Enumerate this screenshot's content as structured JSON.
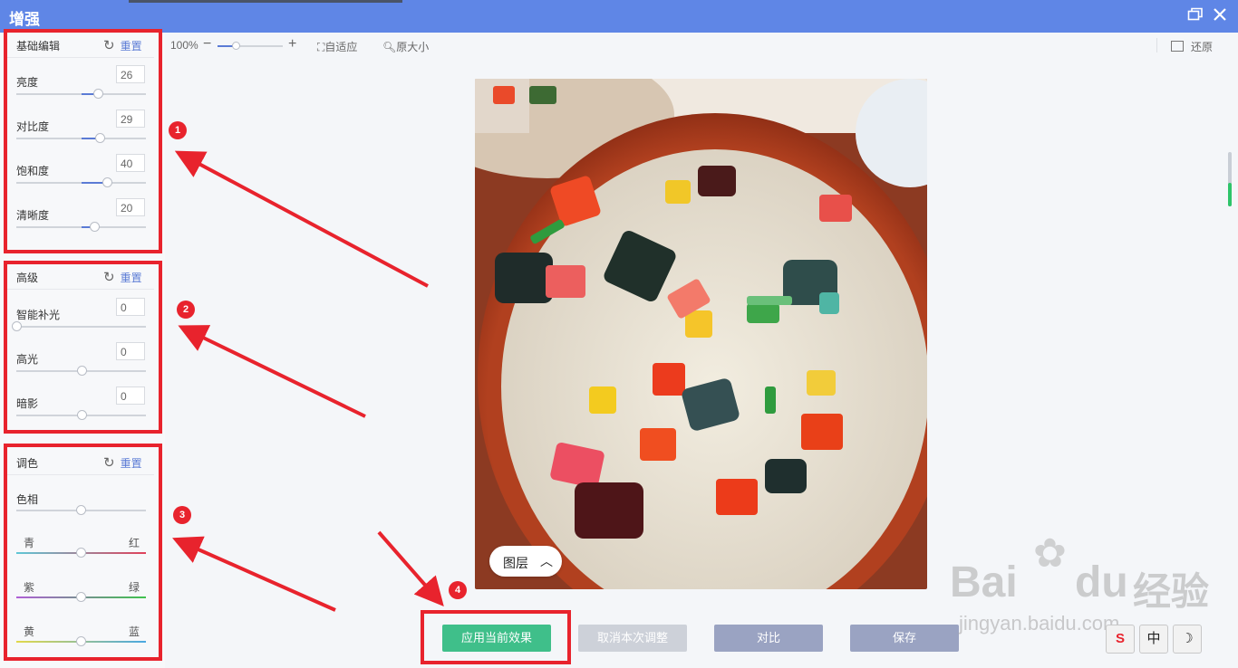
{
  "window": {
    "title": "增强",
    "restore_icon": "window-restore-icon",
    "close_icon": "close-icon"
  },
  "panels": {
    "basic": {
      "title": "基础编辑",
      "reset_label": "重置",
      "controls": [
        {
          "label": "亮度",
          "value": "26",
          "level": 0.26
        },
        {
          "label": "对比度",
          "value": "29",
          "level": 0.29
        },
        {
          "label": "饱和度",
          "value": "40",
          "level": 0.4
        },
        {
          "label": "清晰度",
          "value": "20",
          "level": 0.2
        }
      ]
    },
    "advanced": {
      "title": "高级",
      "reset_label": "重置",
      "controls": [
        {
          "label": "智能补光",
          "value": "0",
          "level": 0
        },
        {
          "label": "高光",
          "value": "0",
          "level": 0
        },
        {
          "label": "暗影",
          "value": "0",
          "level": 0
        }
      ]
    },
    "tone": {
      "title": "调色",
      "reset_label": "重置",
      "hue_label": "色相",
      "balance": [
        {
          "left": "青",
          "right": "红",
          "left_color": "#5fc7d6",
          "right_color": "#e0415a"
        },
        {
          "left": "紫",
          "right": "绿",
          "left_color": "#b05fd6",
          "right_color": "#3fc24d"
        },
        {
          "left": "黄",
          "right": "蓝",
          "left_color": "#e2d94a",
          "right_color": "#4aa8e2"
        }
      ]
    }
  },
  "toolbar": {
    "zoom": "100%",
    "fit_label": "自适应",
    "original_label": "原大小",
    "restore_label": "还原"
  },
  "layer_button": {
    "label": "图层"
  },
  "actions": {
    "apply": "应用当前效果",
    "cancel": "取消本次调整",
    "compare": "对比",
    "save": "保存"
  },
  "badges": [
    "1",
    "2",
    "3",
    "4"
  ],
  "watermark": {
    "brand": "Bai",
    "brand2": "du",
    "cn": "经验",
    "url": "jingyan.baidu.com"
  },
  "ime": {
    "s": "S",
    "zh": "中",
    "moon": "☽"
  },
  "colors": {
    "title_bar": "#5f86e6",
    "accent": "#5b7bd5",
    "apply": "#3fbf8a",
    "annotation": "#e8232d"
  }
}
